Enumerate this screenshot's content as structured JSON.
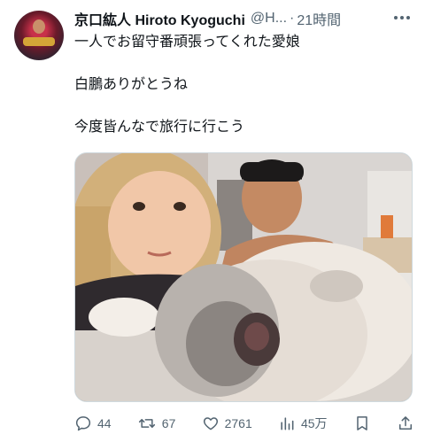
{
  "tweet": {
    "author_name": "京口紘人 Hiroto Kyoguchi",
    "handle": "@H...",
    "separator": "·",
    "time": "21時間",
    "lines": [
      "一人でお留守番頑張ってくれた愛娘",
      "白鵬ありがとうね",
      "今度皆んなで旅行に行こう"
    ]
  },
  "actions": {
    "replies": "44",
    "retweets": "67",
    "likes": "2761",
    "views": "45万"
  },
  "icons": [
    "more-icon",
    "reply-icon",
    "retweet-icon",
    "like-icon",
    "views-icon",
    "bookmark-icon",
    "share-icon"
  ],
  "colors": {
    "text": "#0f1419",
    "secondary": "#536471",
    "border": "#cfd9de"
  }
}
